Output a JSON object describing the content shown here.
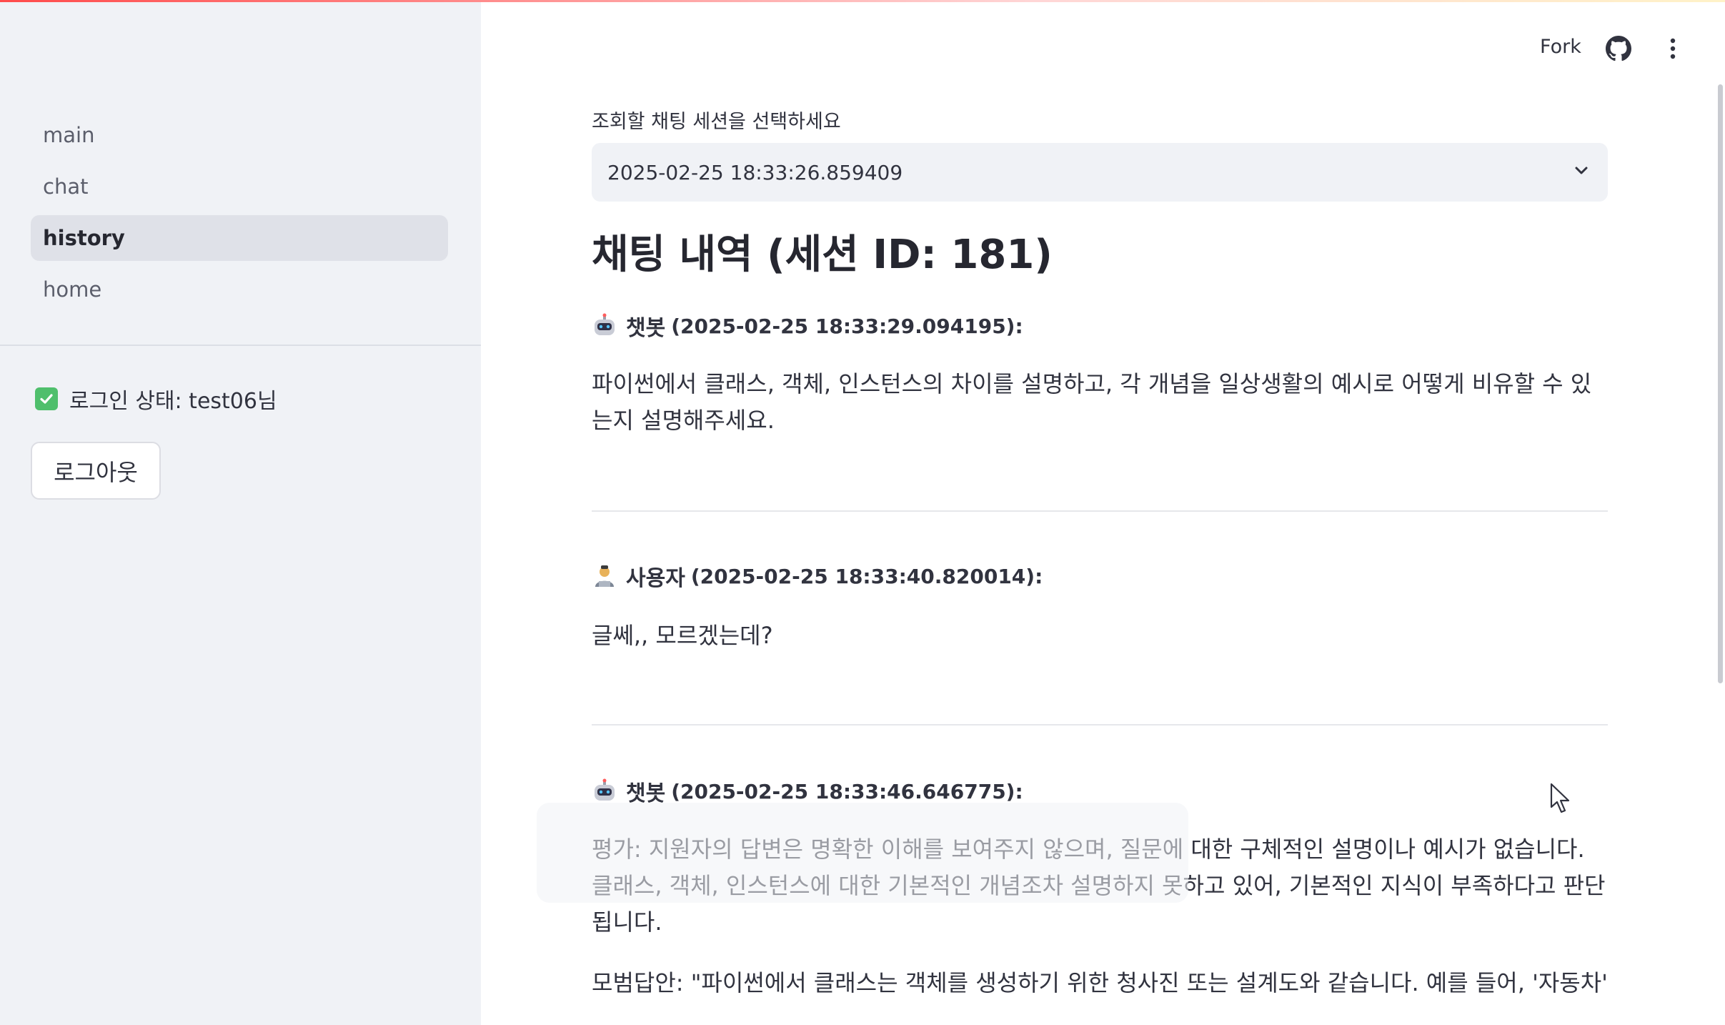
{
  "header": {
    "fork_label": "Fork"
  },
  "sidebar": {
    "nav": [
      {
        "label": "main"
      },
      {
        "label": "chat"
      },
      {
        "label": "history"
      },
      {
        "label": "home"
      }
    ],
    "active_item": "history",
    "login_status": "로그인 상태: test06님",
    "logout_label": "로그아웃"
  },
  "main": {
    "select_label": "조회할 채팅 세션을 선택하세요",
    "select_value": "2025-02-25 18:33:26.859409",
    "title": "채팅 내역 (세션 ID: 181)",
    "messages": [
      {
        "speaker": "챗봇",
        "timestamp": "(2025-02-25 18:33:29.094195):",
        "text": "파이썬에서 클래스, 객체, 인스턴스의 차이를 설명하고, 각 개념을 일상생활의 예시로 어떻게 비유할 수 있는지 설명해주세요."
      },
      {
        "speaker": "사용자",
        "timestamp": "(2025-02-25 18:33:40.820014):",
        "text": "글쎄,, 모르겠는데?"
      },
      {
        "speaker": "챗봇",
        "timestamp": "(2025-02-25 18:33:46.646775):",
        "text": "평가: 지원자의 답변은 명확한 이해를 보여주지 않으며, 질문에 대한 구체적인 설명이나 예시가 없습니다. 클래스, 객체, 인스턴스에 대한 기본적인 개념조차 설명하지 못하고 있어, 기본적인 지식이 부족하다고 판단됩니다.",
        "text2": "모범답안: \"파이썬에서 클래스는 객체를 생성하기 위한 청사진 또는 설계도와 같습니다. 예를 들어, '자동차'라는 클래스가 있을 경우, 이 클래스는 자동차의 속성(브랜드, 색상)과 행동(주행, 정지)을 정의한"
      }
    ]
  },
  "colors": {
    "sidebar_bg": "#f0f2f6",
    "active_nav_bg": "#dfe1e8",
    "check_green": "#4fbf6c",
    "text": "#31333f"
  },
  "icons": [
    "github-icon",
    "kebab-menu-icon",
    "chevron-down-icon",
    "checkbox-checked-icon",
    "robot-icon",
    "user-icon",
    "mouse-cursor-icon"
  ]
}
